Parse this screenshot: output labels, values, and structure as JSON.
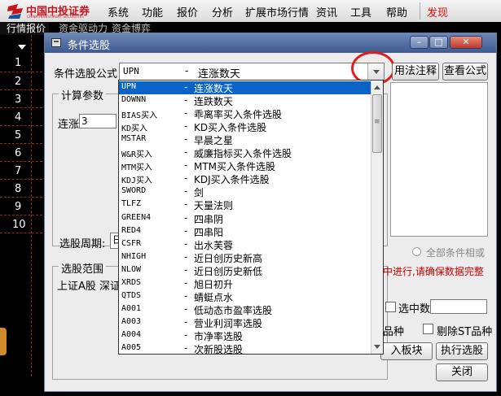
{
  "app": {
    "logo_cn": "中国中投证券",
    "logo_en": "CHINA INVESTMENT SECURITIES",
    "menu": [
      "系统",
      "功能",
      "报价",
      "分析",
      "扩展市场行情",
      "资讯",
      "工具",
      "帮助",
      "发现"
    ]
  },
  "tabs": [
    "行情报价",
    "资金驱动力",
    "资金博弈"
  ],
  "row_numbers": [
    "1",
    "2",
    "3",
    "4",
    "5",
    "6",
    "7",
    "8",
    "9",
    "10"
  ],
  "dialog": {
    "title": "条件选股",
    "formula_label": "条件选股公式",
    "selected_code": "UPN",
    "selected_dash": "-",
    "selected_name": "连涨数天",
    "btn_usage": "用法注释",
    "btn_view_formula": "查看公式",
    "calc_params_title": "计算参数",
    "param_label": "连涨",
    "param_value": "3",
    "period_label": "选股周期:",
    "period_value": "日",
    "range_title": "选股范围",
    "range_text": "上证A股 深证",
    "radio_all_label": "全部条件相或",
    "warn_text": "中进行,请确保数据完整",
    "selected_count_label": "选中数",
    "include_label": "的品种",
    "exclude_st_label": "剔除ST品种",
    "btn_add_block": "入板块",
    "btn_execute": "执行选股",
    "btn_close": "关闭"
  },
  "dropdown": {
    "items": [
      {
        "code": "UPN",
        "dash": "-",
        "name": "连涨数天",
        "selected": true
      },
      {
        "code": "DOWNN",
        "dash": "-",
        "name": "连跌数天"
      },
      {
        "code": "BIAS买入",
        "dash": "-",
        "name": "乖离率买入条件选股"
      },
      {
        "code": "KD买入",
        "dash": "-",
        "name": "KD买入条件选股"
      },
      {
        "code": "MSTAR",
        "dash": "-",
        "name": "早晨之星"
      },
      {
        "code": "W&R买入",
        "dash": "-",
        "name": "威廉指标买入条件选股"
      },
      {
        "code": "MTM买入",
        "dash": "-",
        "name": "MTM买入条件选股"
      },
      {
        "code": "KDJ买入",
        "dash": "-",
        "name": "KDJ买入条件选股"
      },
      {
        "code": "SWORD",
        "dash": "-",
        "name": "剑"
      },
      {
        "code": "TLFZ",
        "dash": "-",
        "name": "天量法则"
      },
      {
        "code": "GREEN4",
        "dash": "-",
        "name": "四串阴"
      },
      {
        "code": "RED4",
        "dash": "-",
        "name": "四串阳"
      },
      {
        "code": "CSFR",
        "dash": "-",
        "name": "出水芙蓉"
      },
      {
        "code": "NHIGH",
        "dash": "-",
        "name": "近日创历史新高"
      },
      {
        "code": "NLOW",
        "dash": "-",
        "name": "近日创历史新低"
      },
      {
        "code": "XRDS",
        "dash": "-",
        "name": "旭日初升"
      },
      {
        "code": "QTDS",
        "dash": "-",
        "name": "蜻蜓点水"
      },
      {
        "code": "A001",
        "dash": "-",
        "name": "低动态市盈率选股"
      },
      {
        "code": "A003",
        "dash": "-",
        "name": "营业利润率选股"
      },
      {
        "code": "A004",
        "dash": "-",
        "name": "市净率选股"
      },
      {
        "code": "A005",
        "dash": "-",
        "name": "次新股选股"
      }
    ]
  }
}
